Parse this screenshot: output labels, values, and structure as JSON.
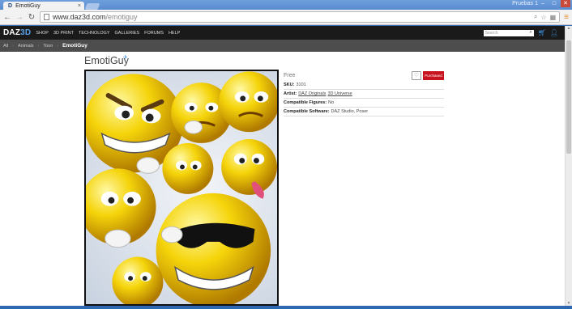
{
  "browser": {
    "tab_title": "EmotiGuy",
    "tab_logo": "D",
    "tab_close": "×",
    "window_user": "Pruebas 1",
    "url_domain": "www.daz3d.com",
    "url_path": "/emotiguy",
    "icons": [
      "back-icon",
      "forward-icon",
      "reload-icon",
      "page-icon",
      "search-icon",
      "star-icon",
      "extension-icon",
      "menu-icon"
    ]
  },
  "site": {
    "brand_daz": "DAZ",
    "brand_3d": "3D",
    "nav": [
      "SHOP",
      "3D PRINT",
      "TECHNOLOGY",
      "GALLERIES",
      "FORUMS",
      "HELP"
    ],
    "search_placeholder": "Search",
    "breadcrumb": [
      "All",
      "Animals",
      "Toon"
    ],
    "breadcrumb_current": "EmotiGuy"
  },
  "product": {
    "title": "EmotiGuy",
    "price": "Free",
    "wishlist_icon": "♡",
    "buy_label": "Purchased",
    "sku_label": "SKU:",
    "sku_value": "3101",
    "artist_label": "Artist:",
    "artists": [
      "DAZ Originals",
      "3D Universe"
    ],
    "figures_label": "Compatible Figures:",
    "figures_value": "No",
    "software_label": "Compatible Software:",
    "software_value": "DAZ Studio, Poser"
  },
  "colors": {
    "accent": "#c8141e",
    "brand_blue": "#3b8fe0",
    "navbar": "#1a1a1a",
    "breadbar": "#4d4d4d"
  }
}
